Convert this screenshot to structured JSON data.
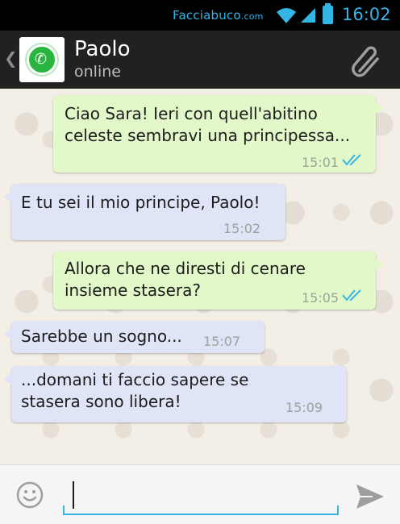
{
  "statusbar": {
    "brand_main": "Facciabuco",
    "brand_suffix": ".com",
    "time": "16:02"
  },
  "header": {
    "contact_name": "Paolo",
    "contact_status": "online"
  },
  "messages": [
    {
      "direction": "out",
      "text_lines": [
        "Ciao Sara! Ieri con quell'abitino",
        "celeste sembravi una principessa..."
      ],
      "time": "15:01",
      "read": true
    },
    {
      "direction": "in",
      "text_lines": [
        "E tu sei il mio principe, Paolo!"
      ],
      "time": "15:02"
    },
    {
      "direction": "out",
      "text_lines": [
        "Allora che ne diresti di cenare",
        "insieme stasera?"
      ],
      "time": "15:05",
      "read": true
    },
    {
      "direction": "in",
      "text_lines": [
        "Sarebbe un sogno..."
      ],
      "time": "15:07"
    },
    {
      "direction": "in",
      "text_lines": [
        "...domani ti faccio sapere se",
        "stasera sono libera!"
      ],
      "time": "15:09"
    }
  ],
  "composer": {
    "value": "",
    "placeholder": ""
  },
  "colors": {
    "accent": "#33b5e5",
    "outgoing_bubble": "#e2f8c8",
    "incoming_bubble": "#dfe4f6",
    "header_bg": "#212121",
    "whatsapp_green": "#2ab540"
  },
  "icons": {
    "back": "chevron-left-icon",
    "avatar": "whatsapp-logo-icon",
    "attach": "paperclip-icon",
    "emoji": "smiley-icon",
    "send": "send-arrow-icon",
    "read": "double-check-icon",
    "wifi": "wifi-icon",
    "signal": "signal-icon",
    "battery": "battery-icon"
  }
}
